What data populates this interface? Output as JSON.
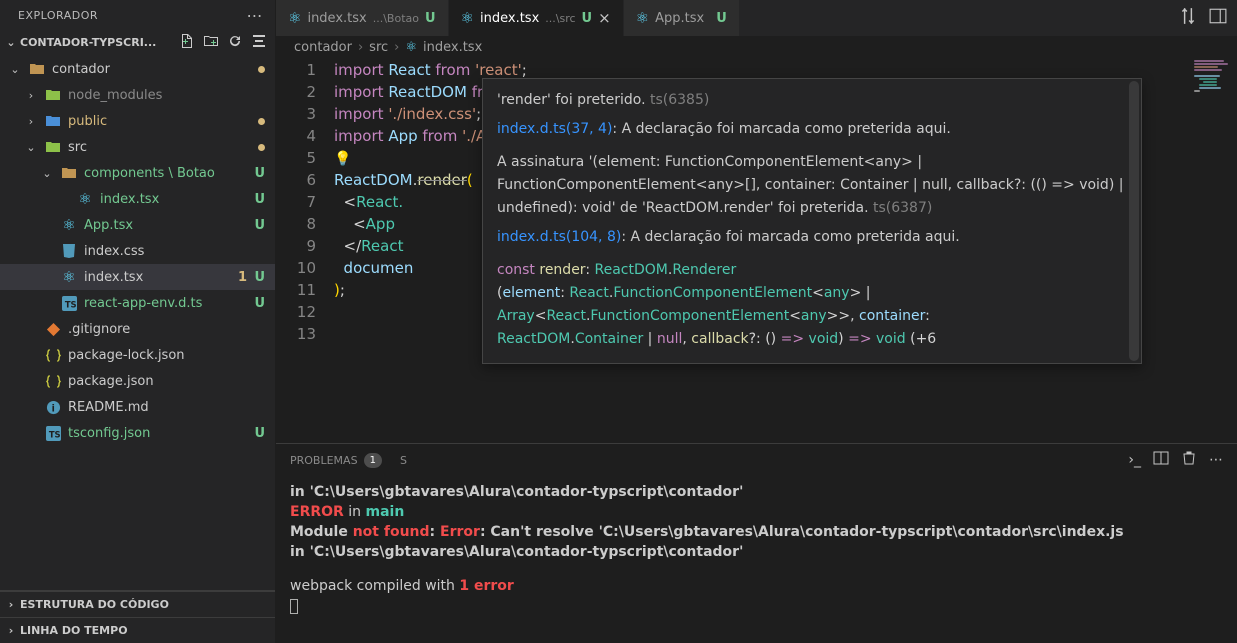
{
  "sidebar": {
    "title": "EXPLORADOR",
    "project": "CONTADOR-TYPSCRI...",
    "toolbar_icons": [
      "new-file-icon",
      "new-folder-icon",
      "refresh-icon",
      "collapse-icon"
    ],
    "tree": [
      {
        "depth": 0,
        "chev": "v",
        "icon": "folder",
        "color": "ic-folder",
        "label": "contador",
        "dot": "m-dot"
      },
      {
        "depth": 1,
        "chev": ">",
        "icon": "folder",
        "color": "ic-green",
        "label": "node_modules",
        "muted": true
      },
      {
        "depth": 1,
        "chev": ">",
        "icon": "folder",
        "color": "ic-folder-blue",
        "label": "public",
        "colorText": "#d7ba7d",
        "dot": "m-dot"
      },
      {
        "depth": 1,
        "chev": "v",
        "icon": "folder",
        "color": "ic-green",
        "label": "src",
        "dot": "m-dot"
      },
      {
        "depth": 2,
        "chev": "v",
        "icon": "folder",
        "color": "ic-folder",
        "label": "components \\ Botao",
        "colorText": "#73c991",
        "status": "U"
      },
      {
        "depth": 3,
        "icon": "react",
        "color": "ic-react",
        "label": "index.tsx",
        "colorText": "#73c991",
        "status": "U"
      },
      {
        "depth": 2,
        "icon": "react",
        "color": "ic-react",
        "label": "App.tsx",
        "colorText": "#73c991",
        "status": "U"
      },
      {
        "depth": 2,
        "icon": "css",
        "color": "ic-css",
        "label": "index.css"
      },
      {
        "depth": 2,
        "icon": "react",
        "color": "ic-react",
        "label": "index.tsx",
        "selected": true,
        "status": "U",
        "badgeColor": "#d7ba7d",
        "badgeText": "1"
      },
      {
        "depth": 2,
        "icon": "ts",
        "color": "ic-ts",
        "label": "react-app-env.d.ts",
        "colorText": "#73c991",
        "status": "U"
      },
      {
        "depth": 1,
        "icon": "git",
        "color": "ic-git",
        "label": ".gitignore"
      },
      {
        "depth": 1,
        "icon": "json",
        "color": "ic-json",
        "label": "package-lock.json"
      },
      {
        "depth": 1,
        "icon": "json",
        "color": "ic-json",
        "label": "package.json"
      },
      {
        "depth": 1,
        "icon": "readme",
        "color": "ic-readme",
        "label": "README.md"
      },
      {
        "depth": 1,
        "icon": "ts",
        "color": "ic-ts",
        "label": "tsconfig.json",
        "colorText": "#73c991",
        "status": "U"
      }
    ],
    "sections": [
      "ESTRUTURA DO CÓDIGO",
      "LINHA DO TEMPO"
    ]
  },
  "tabs": [
    {
      "icon": "react",
      "label": "index.tsx",
      "suffix": "...\\Botao",
      "vcs": "U",
      "vcsColor": "#73c991"
    },
    {
      "icon": "react",
      "label": "index.tsx",
      "suffix": "...\\src",
      "vcs": "U",
      "vcsColor": "#73c991",
      "active": true,
      "close": "×"
    },
    {
      "icon": "react",
      "label": "App.tsx",
      "suffix": "",
      "vcs": "U",
      "vcsColor": "#73c991"
    }
  ],
  "breadcrumb": [
    "contador",
    "src",
    "index.tsx"
  ],
  "breadcrumb_icon": "react",
  "code": {
    "lines": [
      {
        "n": 1,
        "html": "<span class='tok-kw'>import</span> <span class='tok-var'>React</span> <span class='tok-kw'>from</span> <span class='tok-str'>'react'</span><span class='tok-punc'>;</span>"
      },
      {
        "n": 2,
        "html": "<span class='tok-kw'>import</span> <span class='tok-var'>ReactDOM</span> <span class='tok-kw'>from</span> <span class='tok-str'>'react-dom'</span><span class='tok-punc'>;</span>"
      },
      {
        "n": 3,
        "html": "<span class='tok-kw'>import</span> <span class='tok-str'>'./index.css'</span><span class='tok-punc'>;</span>"
      },
      {
        "n": 4,
        "html": "<span class='tok-kw'>import</span> <span class='tok-var'>App</span> <span class='tok-kw'>from</span> <span class='tok-str'>'./App'</span><span class='tok-punc'>;</span>"
      },
      {
        "n": 5,
        "html": "<span class='bulb'>💡</span>"
      },
      {
        "n": 6,
        "html": "<span class='tok-var'>ReactDOM</span><span class='tok-punc'>.</span><span class='hv-fn strike'>render</span><span class='tok-brace'>(</span>"
      },
      {
        "n": 7,
        "html": "  <span class='tok-punc'>&lt;</span><span class='tok-tag'>React.</span>"
      },
      {
        "n": 8,
        "html": "    <span class='tok-punc'>&lt;</span><span class='tok-tag'>App</span>"
      },
      {
        "n": 9,
        "html": "  <span class='tok-punc'>&lt;/</span><span class='tok-tag'>React</span>"
      },
      {
        "n": 10,
        "html": "  <span class='tok-var'>documen</span>"
      },
      {
        "n": 11,
        "html": "<span class='tok-brace'>)</span><span class='tok-punc'>;</span>"
      },
      {
        "n": 12,
        "html": ""
      },
      {
        "n": 13,
        "html": ""
      }
    ]
  },
  "hover": {
    "l1a": "'render' foi preterido.",
    "l1b": "ts(6385)",
    "l2a": "index.d.ts(37, 4)",
    "l2b": ": A declaração foi marcada como preterida aqui.",
    "l3": "A assinatura '(element: FunctionComponentElement<any> | FunctionComponentElement<any>[], container: Container | null, callback?: (() => void) | undefined): void' de 'ReactDOM.render' foi preterida. ",
    "l3b": "ts(6387)",
    "l4a": "index.d.ts(104, 8)",
    "l4b": ": A declaração foi marcada como preterida aqui.",
    "sig": "const render: ReactDOM.Renderer",
    "sig2": "(element: React.FunctionComponentElement<any> | Array<React.FunctionComponentElement<any>>, container: ReactDOM.Container | null, callback?: () => void) => void (+6"
  },
  "panel": {
    "tab_problems": "PROBLEMAS",
    "badge": "1",
    "tab_s": "S",
    "icons": [
      "terminal-icon",
      "split-icon",
      "trash-icon",
      "more-icon"
    ]
  },
  "terminal": {
    "l1": "  in 'C:\\Users\\gbtavares\\Alura\\contador-typscript\\contador'",
    "l2a": "ERROR",
    "l2b": " in ",
    "l2c": "main",
    "l3a": "Module ",
    "l3b": "not found",
    "l3c": ": ",
    "l3d": "Error",
    "l3e": ": Can't resolve 'C:\\Users\\gbtavares\\Alura\\contador-typscript\\contador\\src\\index.js",
    "l4": "  in 'C:\\Users\\gbtavares\\Alura\\contador-typscript\\contador'",
    "l5a": "webpack compiled with ",
    "l5b": "1 error"
  }
}
